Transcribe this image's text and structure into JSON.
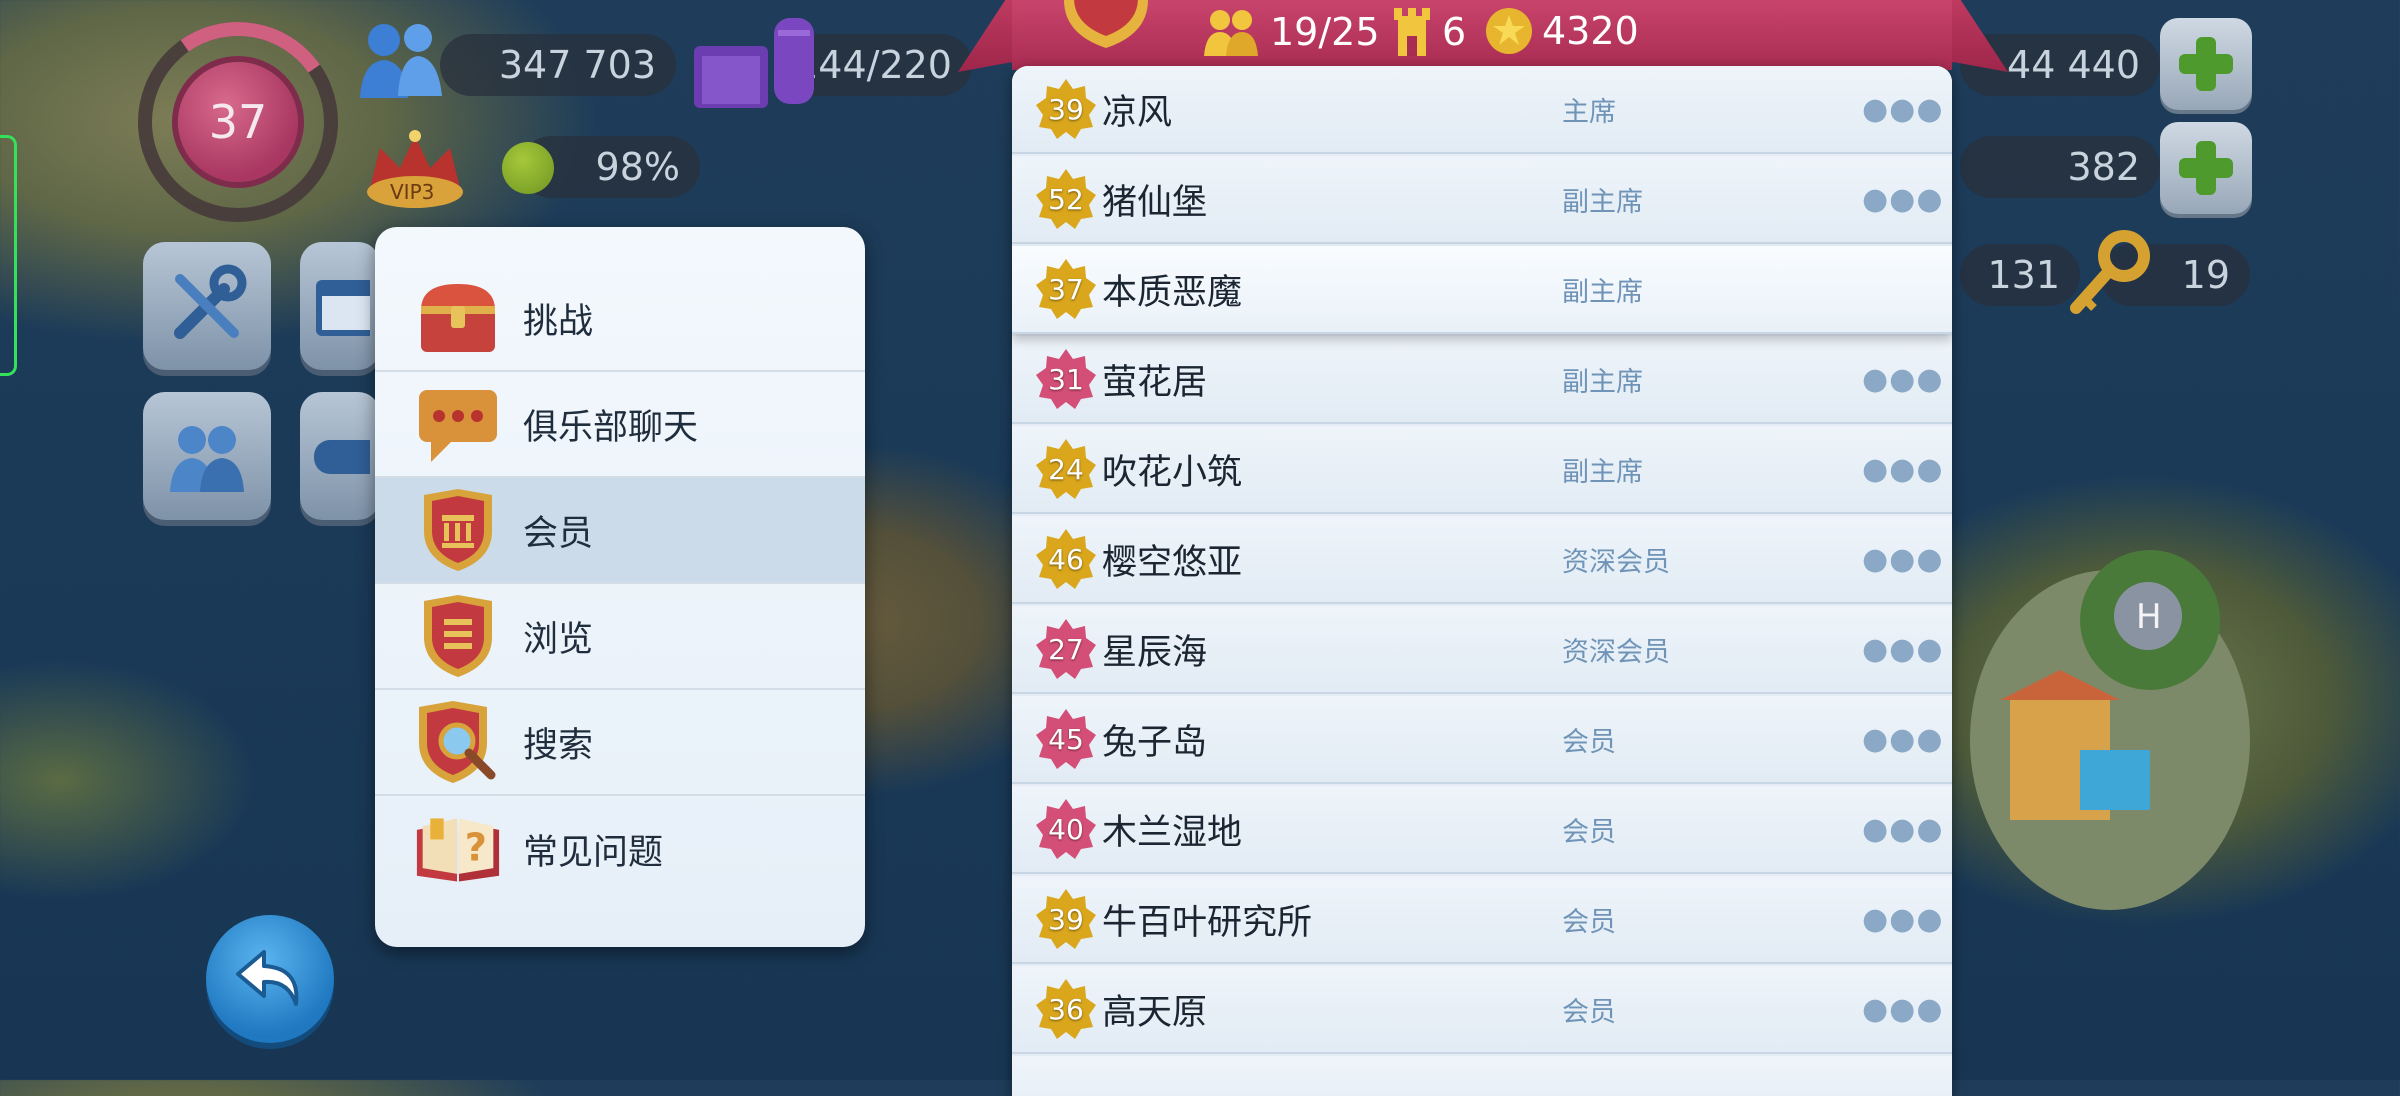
{
  "hud": {
    "level": "37",
    "population": "347 703",
    "storage": "144/220",
    "vip": "VIP3",
    "happiness": "98%",
    "simcash": "44 440",
    "golden_keys_small": "382",
    "tokens": "131",
    "keys": "19"
  },
  "club": {
    "members": "19/25",
    "wars": "6",
    "points": "4320"
  },
  "menu": {
    "items": [
      {
        "label": "挑战",
        "icon": "treasure-chest-icon"
      },
      {
        "label": "俱乐部聊天",
        "icon": "chat-bubble-icon"
      },
      {
        "label": "会员",
        "icon": "members-shield-icon"
      },
      {
        "label": "浏览",
        "icon": "browse-shield-icon"
      },
      {
        "label": "搜索",
        "icon": "search-shield-icon"
      },
      {
        "label": "常见问题",
        "icon": "faq-book-icon"
      }
    ]
  },
  "members": [
    {
      "level": "39",
      "name": "凉风",
      "role": "主席",
      "badge": "gold"
    },
    {
      "level": "52",
      "name": "猪仙堡",
      "role": "副主席",
      "badge": "gold"
    },
    {
      "level": "37",
      "name": "本质恶魔",
      "role": "副主席",
      "badge": "gold"
    },
    {
      "level": "31",
      "name": "萤花居",
      "role": "副主席",
      "badge": "pink"
    },
    {
      "level": "24",
      "name": "吹花小筑",
      "role": "副主席",
      "badge": "gold"
    },
    {
      "level": "46",
      "name": "樱空悠亚",
      "role": "资深会员",
      "badge": "gold"
    },
    {
      "level": "27",
      "name": "星辰海",
      "role": "资深会员",
      "badge": "pink"
    },
    {
      "level": "45",
      "name": "兔子岛",
      "role": "会员",
      "badge": "pink"
    },
    {
      "level": "40",
      "name": "木兰湿地",
      "role": "会员",
      "badge": "pink"
    },
    {
      "level": "39",
      "name": "牛百叶研究所",
      "role": "会员",
      "badge": "gold"
    },
    {
      "level": "36",
      "name": "高天原",
      "role": "会员",
      "badge": "gold"
    }
  ],
  "more_glyph": "●●●",
  "colors": {
    "gold": "#d9a61c",
    "pink": "#d44f78"
  }
}
